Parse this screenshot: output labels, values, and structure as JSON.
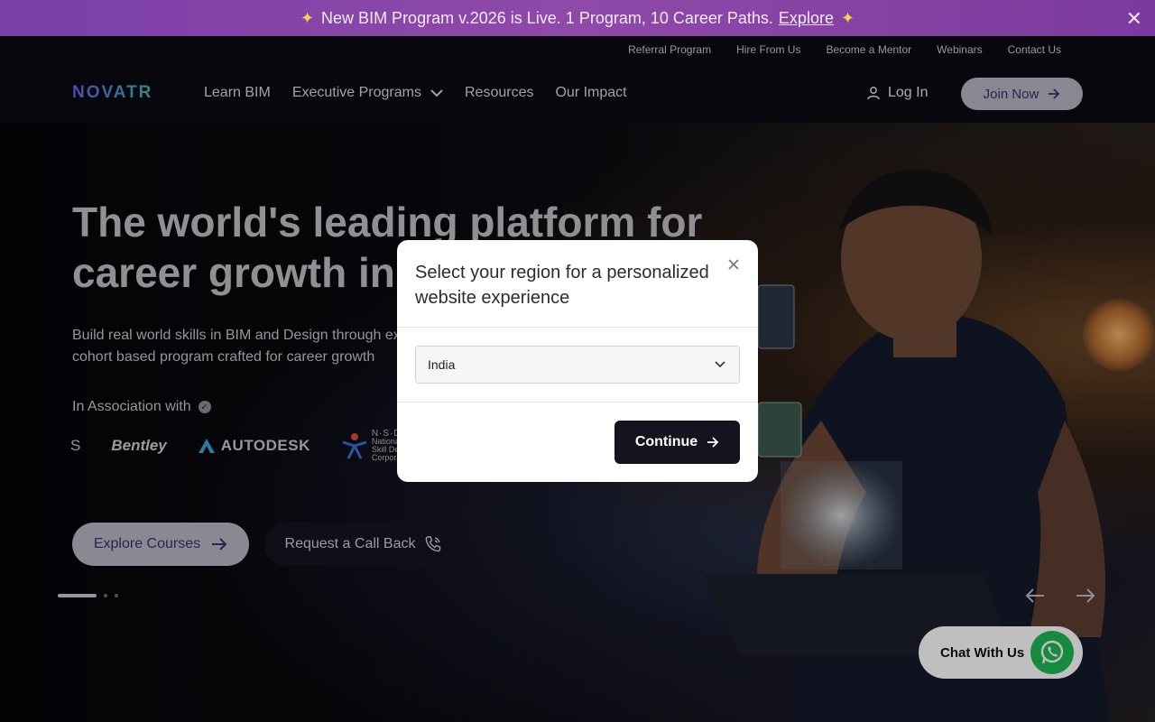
{
  "announcement": {
    "text": "New BIM Program v.2026 is Live. 1 Program, 10 Career Paths.",
    "link": "Explore",
    "close": "✕",
    "color": "#7a3fa8"
  },
  "header": {
    "utility": [
      "Referral Program",
      "Hire From Us",
      "Become a Mentor",
      "Webinars",
      "Contact Us"
    ],
    "logo": "NOVATR",
    "nav": [
      {
        "label": "Learn BIM",
        "has_dropdown": false
      },
      {
        "label": "Executive Programs",
        "has_dropdown": true
      },
      {
        "label": "Resources",
        "has_dropdown": false
      },
      {
        "label": "Our Impact",
        "has_dropdown": false
      }
    ],
    "login": "Log In",
    "join": "Join Now"
  },
  "hero": {
    "headline": "The world's leading platform for career growth in",
    "subtext": "Build real world skills in BIM and Design through ex cohort based program crafted for career growth",
    "association": "In Association with",
    "partners": {
      "clipped": "S",
      "bentley": "Bentley",
      "autodesk": "AUTODESK",
      "nsdc_top": "N·S·D·C",
      "nsdc_line1": "National",
      "nsdc_line2": "Skill Develop",
      "nsdc_line3": "Corporation"
    },
    "explore_button": "Explore Courses",
    "callback_button": "Request a Call Back",
    "carousel_slides": 3,
    "carousel_active": 1
  },
  "chat": {
    "label": "Chat With Us",
    "color": "#1fb955"
  },
  "modal": {
    "title": "Select your region for a personalized website experience",
    "region_value": "India",
    "continue_label": "Continue"
  }
}
